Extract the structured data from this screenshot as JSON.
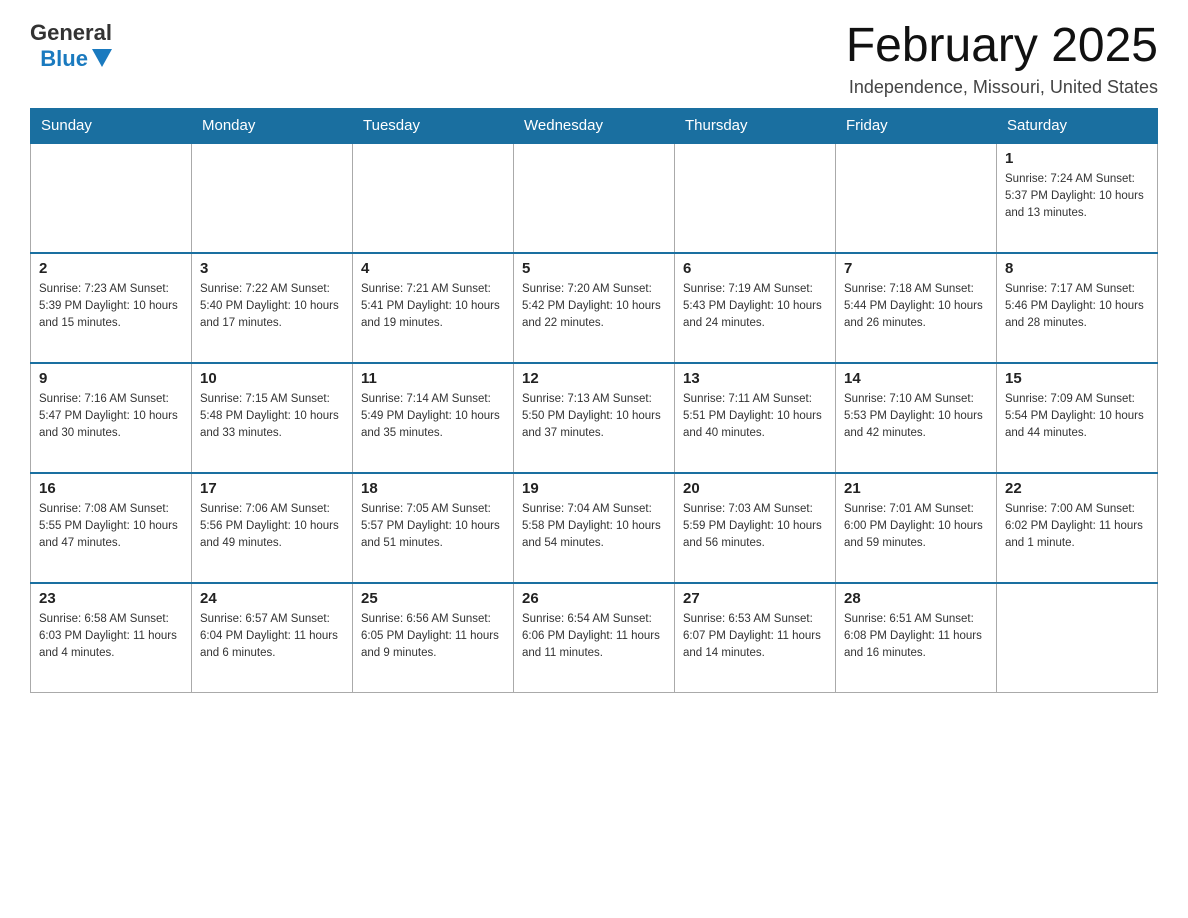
{
  "header": {
    "logo_general": "General",
    "logo_blue": "Blue",
    "month_title": "February 2025",
    "location": "Independence, Missouri, United States"
  },
  "days_of_week": [
    "Sunday",
    "Monday",
    "Tuesday",
    "Wednesday",
    "Thursday",
    "Friday",
    "Saturday"
  ],
  "weeks": [
    [
      {
        "day": "",
        "info": ""
      },
      {
        "day": "",
        "info": ""
      },
      {
        "day": "",
        "info": ""
      },
      {
        "day": "",
        "info": ""
      },
      {
        "day": "",
        "info": ""
      },
      {
        "day": "",
        "info": ""
      },
      {
        "day": "1",
        "info": "Sunrise: 7:24 AM\nSunset: 5:37 PM\nDaylight: 10 hours and 13 minutes."
      }
    ],
    [
      {
        "day": "2",
        "info": "Sunrise: 7:23 AM\nSunset: 5:39 PM\nDaylight: 10 hours and 15 minutes."
      },
      {
        "day": "3",
        "info": "Sunrise: 7:22 AM\nSunset: 5:40 PM\nDaylight: 10 hours and 17 minutes."
      },
      {
        "day": "4",
        "info": "Sunrise: 7:21 AM\nSunset: 5:41 PM\nDaylight: 10 hours and 19 minutes."
      },
      {
        "day": "5",
        "info": "Sunrise: 7:20 AM\nSunset: 5:42 PM\nDaylight: 10 hours and 22 minutes."
      },
      {
        "day": "6",
        "info": "Sunrise: 7:19 AM\nSunset: 5:43 PM\nDaylight: 10 hours and 24 minutes."
      },
      {
        "day": "7",
        "info": "Sunrise: 7:18 AM\nSunset: 5:44 PM\nDaylight: 10 hours and 26 minutes."
      },
      {
        "day": "8",
        "info": "Sunrise: 7:17 AM\nSunset: 5:46 PM\nDaylight: 10 hours and 28 minutes."
      }
    ],
    [
      {
        "day": "9",
        "info": "Sunrise: 7:16 AM\nSunset: 5:47 PM\nDaylight: 10 hours and 30 minutes."
      },
      {
        "day": "10",
        "info": "Sunrise: 7:15 AM\nSunset: 5:48 PM\nDaylight: 10 hours and 33 minutes."
      },
      {
        "day": "11",
        "info": "Sunrise: 7:14 AM\nSunset: 5:49 PM\nDaylight: 10 hours and 35 minutes."
      },
      {
        "day": "12",
        "info": "Sunrise: 7:13 AM\nSunset: 5:50 PM\nDaylight: 10 hours and 37 minutes."
      },
      {
        "day": "13",
        "info": "Sunrise: 7:11 AM\nSunset: 5:51 PM\nDaylight: 10 hours and 40 minutes."
      },
      {
        "day": "14",
        "info": "Sunrise: 7:10 AM\nSunset: 5:53 PM\nDaylight: 10 hours and 42 minutes."
      },
      {
        "day": "15",
        "info": "Sunrise: 7:09 AM\nSunset: 5:54 PM\nDaylight: 10 hours and 44 minutes."
      }
    ],
    [
      {
        "day": "16",
        "info": "Sunrise: 7:08 AM\nSunset: 5:55 PM\nDaylight: 10 hours and 47 minutes."
      },
      {
        "day": "17",
        "info": "Sunrise: 7:06 AM\nSunset: 5:56 PM\nDaylight: 10 hours and 49 minutes."
      },
      {
        "day": "18",
        "info": "Sunrise: 7:05 AM\nSunset: 5:57 PM\nDaylight: 10 hours and 51 minutes."
      },
      {
        "day": "19",
        "info": "Sunrise: 7:04 AM\nSunset: 5:58 PM\nDaylight: 10 hours and 54 minutes."
      },
      {
        "day": "20",
        "info": "Sunrise: 7:03 AM\nSunset: 5:59 PM\nDaylight: 10 hours and 56 minutes."
      },
      {
        "day": "21",
        "info": "Sunrise: 7:01 AM\nSunset: 6:00 PM\nDaylight: 10 hours and 59 minutes."
      },
      {
        "day": "22",
        "info": "Sunrise: 7:00 AM\nSunset: 6:02 PM\nDaylight: 11 hours and 1 minute."
      }
    ],
    [
      {
        "day": "23",
        "info": "Sunrise: 6:58 AM\nSunset: 6:03 PM\nDaylight: 11 hours and 4 minutes."
      },
      {
        "day": "24",
        "info": "Sunrise: 6:57 AM\nSunset: 6:04 PM\nDaylight: 11 hours and 6 minutes."
      },
      {
        "day": "25",
        "info": "Sunrise: 6:56 AM\nSunset: 6:05 PM\nDaylight: 11 hours and 9 minutes."
      },
      {
        "day": "26",
        "info": "Sunrise: 6:54 AM\nSunset: 6:06 PM\nDaylight: 11 hours and 11 minutes."
      },
      {
        "day": "27",
        "info": "Sunrise: 6:53 AM\nSunset: 6:07 PM\nDaylight: 11 hours and 14 minutes."
      },
      {
        "day": "28",
        "info": "Sunrise: 6:51 AM\nSunset: 6:08 PM\nDaylight: 11 hours and 16 minutes."
      },
      {
        "day": "",
        "info": ""
      }
    ]
  ]
}
